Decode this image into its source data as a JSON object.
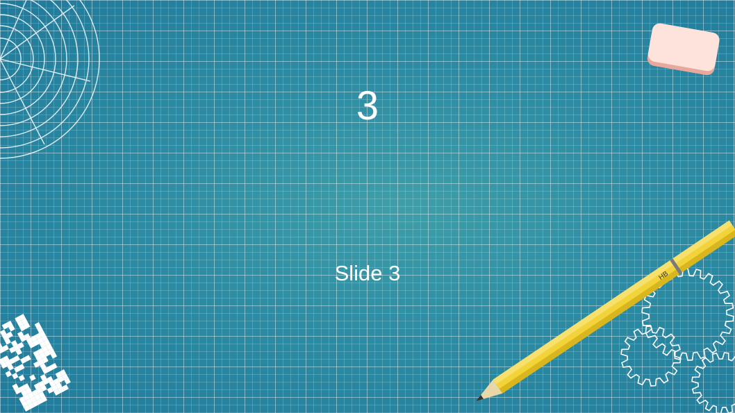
{
  "slide": {
    "number": "3",
    "title": "Slide 3",
    "pencil_label": "HB"
  },
  "colors": {
    "background": "#2d8ca3",
    "grid_line": "#ffffff",
    "pencil": "#f2d33a",
    "eraser": "#fde3dc",
    "text": "#ffffff"
  }
}
